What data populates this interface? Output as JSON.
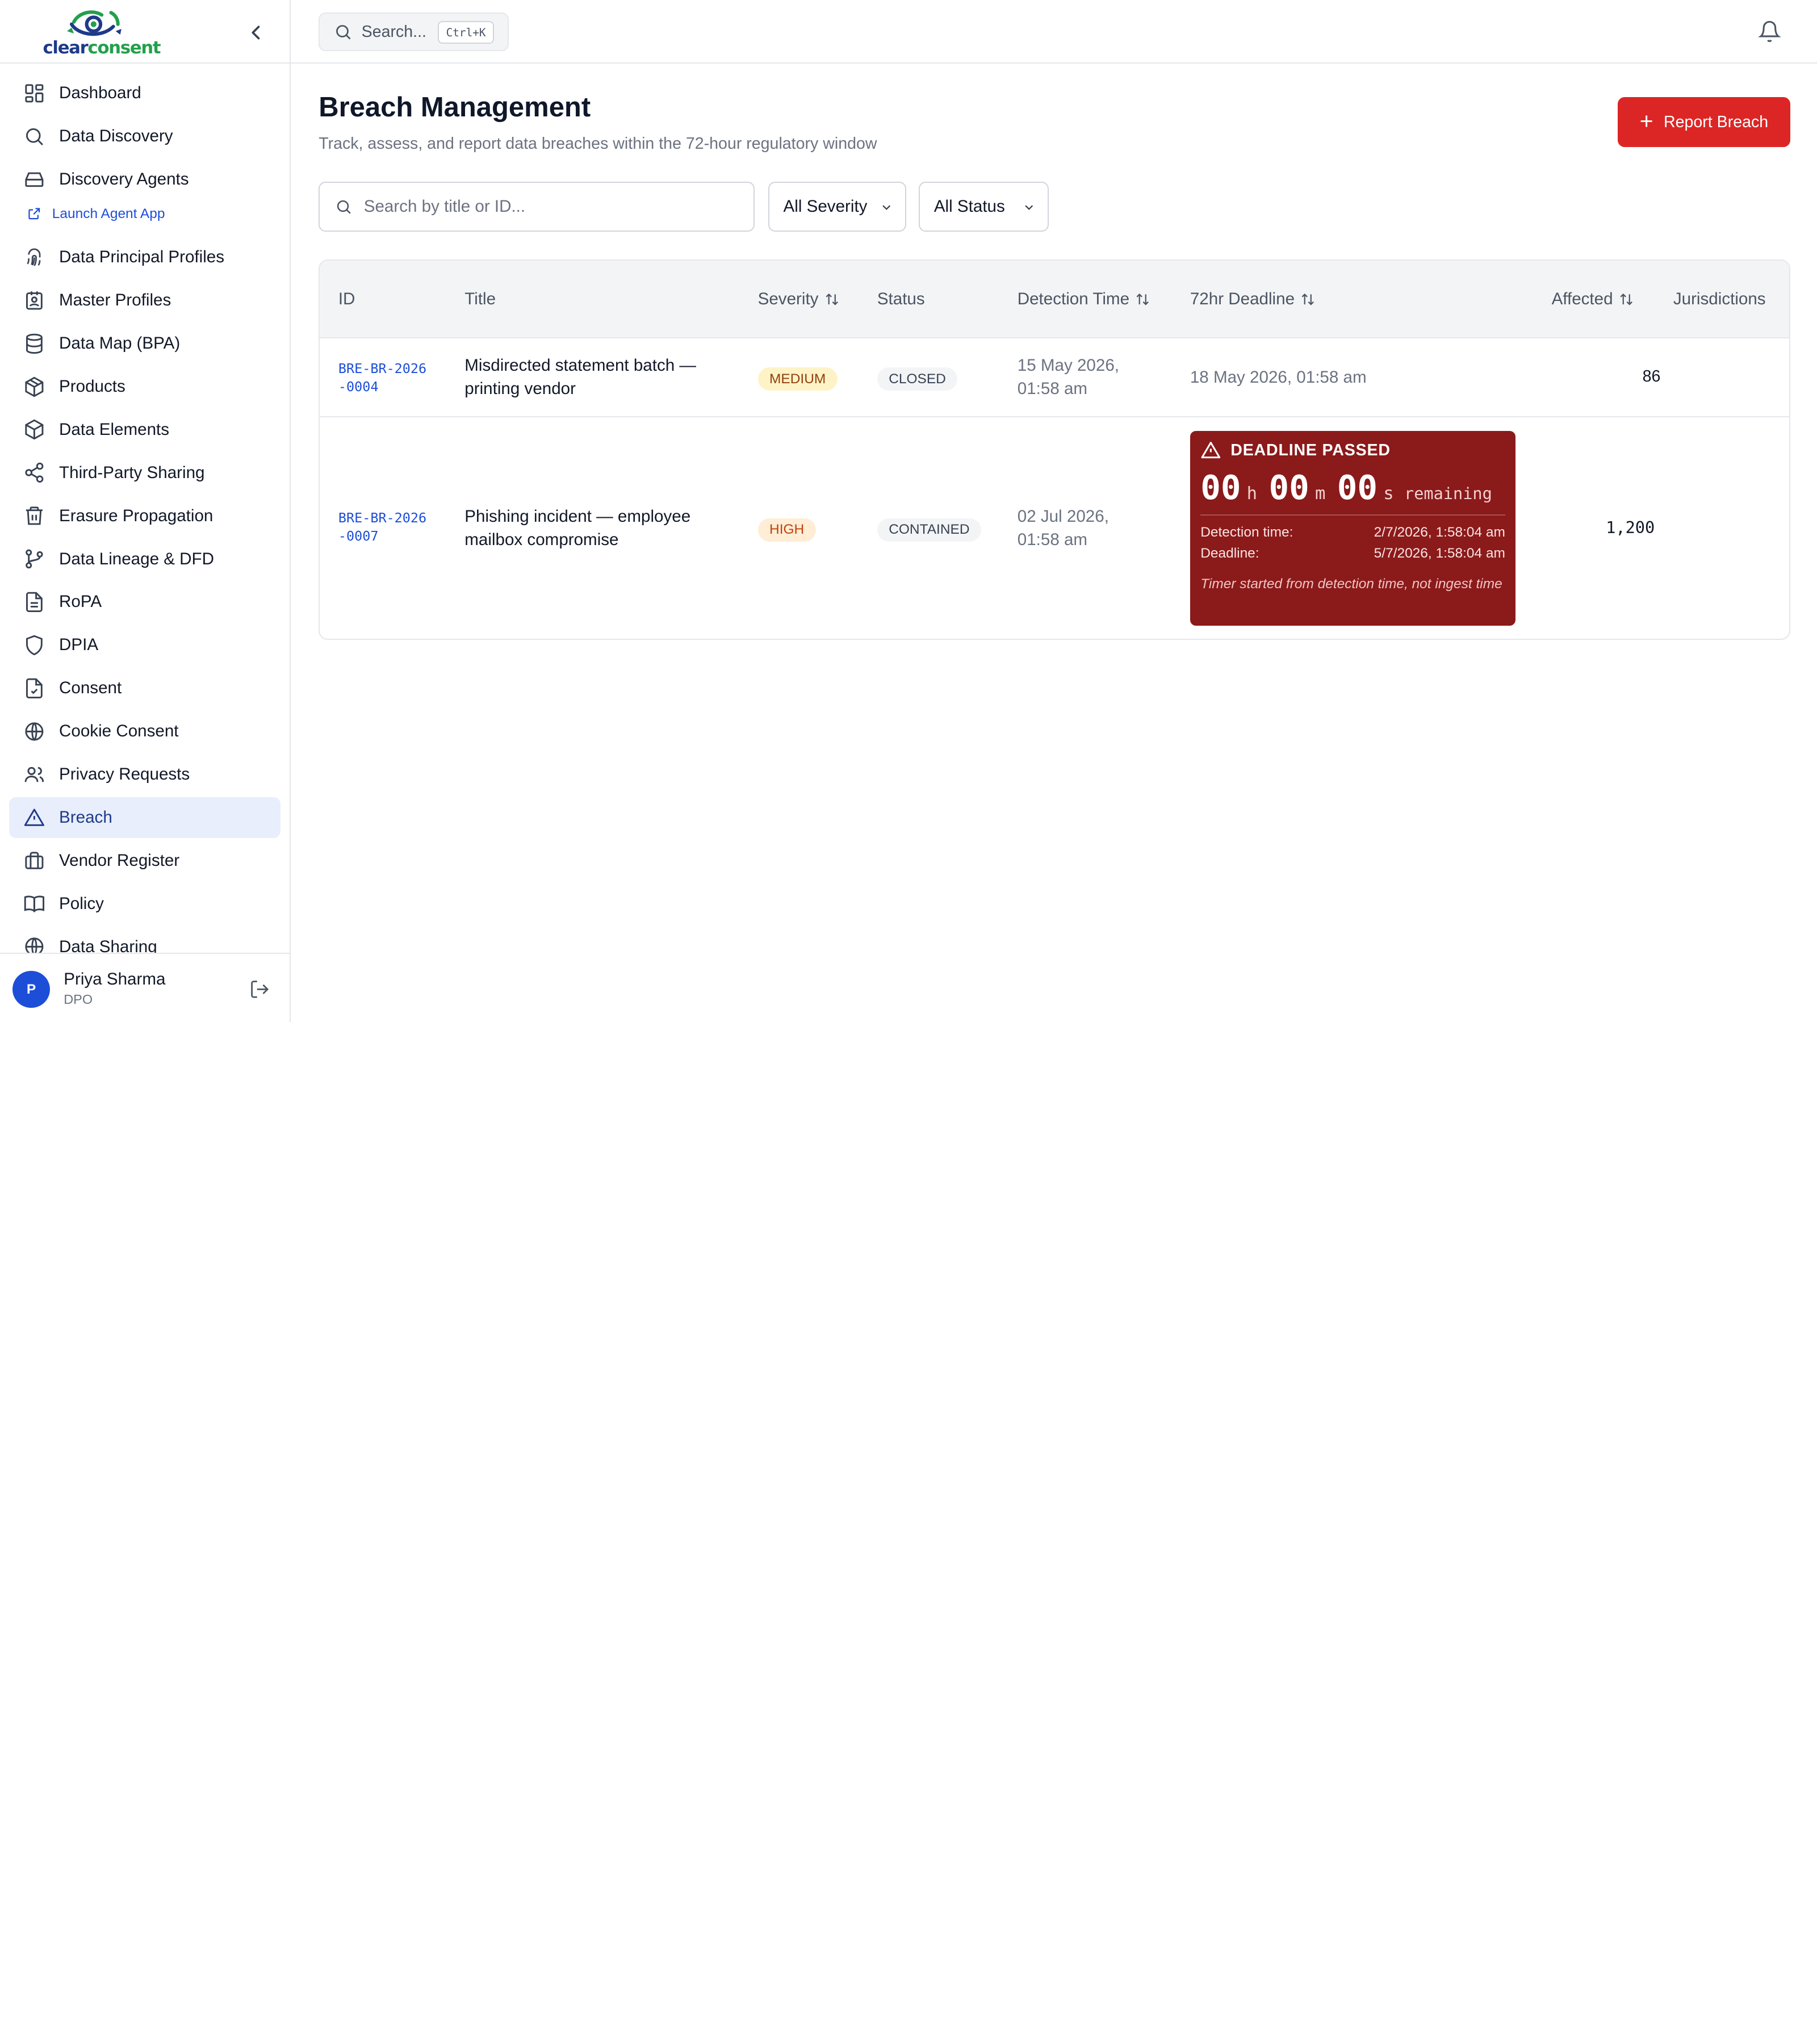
{
  "brand": {
    "name_part1": "clear",
    "name_part2": "consent",
    "color_primary": "#1e3a8a",
    "color_accent": "#22a04b"
  },
  "sidebar": {
    "items": [
      {
        "label": "Dashboard",
        "icon": "grid-icon"
      },
      {
        "label": "Data Discovery",
        "icon": "search-icon"
      },
      {
        "label": "Discovery Agents",
        "icon": "hard-drive-icon"
      },
      {
        "label": "Launch Agent App",
        "icon": "external-link-icon"
      },
      {
        "label": "Data Principal Profiles",
        "icon": "fingerprint-icon"
      },
      {
        "label": "Master Profiles",
        "icon": "id-badge-icon"
      },
      {
        "label": "Data Map (BPA)",
        "icon": "database-icon"
      },
      {
        "label": "Products",
        "icon": "package-icon"
      },
      {
        "label": "Data Elements",
        "icon": "box-icon"
      },
      {
        "label": "Third-Party Sharing",
        "icon": "share-icon"
      },
      {
        "label": "Erasure Propagation",
        "icon": "trash-icon"
      },
      {
        "label": "Data Lineage & DFD",
        "icon": "git-branch-icon"
      },
      {
        "label": "RoPA",
        "icon": "file-text-icon"
      },
      {
        "label": "DPIA",
        "icon": "shield-icon"
      },
      {
        "label": "Consent",
        "icon": "file-check-icon"
      },
      {
        "label": "Cookie Consent",
        "icon": "globe-icon"
      },
      {
        "label": "Privacy Requests",
        "icon": "users-icon"
      },
      {
        "label": "Breach",
        "icon": "alert-triangle-icon"
      },
      {
        "label": "Vendor Register",
        "icon": "briefcase-icon"
      },
      {
        "label": "Policy",
        "icon": "book-icon"
      },
      {
        "label": "Data Sharing",
        "icon": "globe-icon"
      }
    ],
    "active": "Breach"
  },
  "user": {
    "initial": "P",
    "name": "Priya Sharma",
    "role": "DPO"
  },
  "topbar": {
    "search_placeholder": "Search...",
    "shortcut": "Ctrl+K"
  },
  "page": {
    "title": "Breach Management",
    "subtitle": "Track, assess, and report data breaches within the 72-hour regulatory window",
    "report_button": "Report Breach"
  },
  "filters": {
    "search_placeholder": "Search by title or ID...",
    "severity": "All Severity",
    "status": "All Status"
  },
  "table": {
    "columns": {
      "id": "ID",
      "title": "Title",
      "severity": "Severity",
      "status": "Status",
      "detection": "Detection Time",
      "deadline": "72hr Deadline",
      "affected": "Affected",
      "jurisdictions": "Jurisdictions"
    },
    "rows": [
      {
        "id": "BRE-BR-2026-0004",
        "title": "Misdirected statement batch — printing vendor",
        "severity": "MEDIUM",
        "status": "CLOSED",
        "detection": "15 May 2026, 01:58 am",
        "deadline": "18 May 2026, 01:58 am",
        "affected": "86"
      },
      {
        "id": "BRE-BR-2026-0007",
        "title": "Phishing incident — employee mailbox compromise",
        "severity": "HIGH",
        "status": "CONTAINED",
        "detection": "02 Jul 2026, 01:58 am",
        "deadline_box": {
          "heading": "DEADLINE PASSED",
          "hours": "00",
          "minutes": "00",
          "seconds": "00",
          "unit_h": "h",
          "unit_m": "m",
          "unit_s": "s",
          "remaining": "remaining",
          "detection_label": "Detection time:",
          "detection_value": "2/7/2026, 1:58:04 am",
          "deadline_label": "Deadline:",
          "deadline_value": "5/7/2026, 1:58:04 am",
          "note": "Timer started from detection time, not ingest time"
        },
        "affected": "1,200"
      }
    ]
  }
}
